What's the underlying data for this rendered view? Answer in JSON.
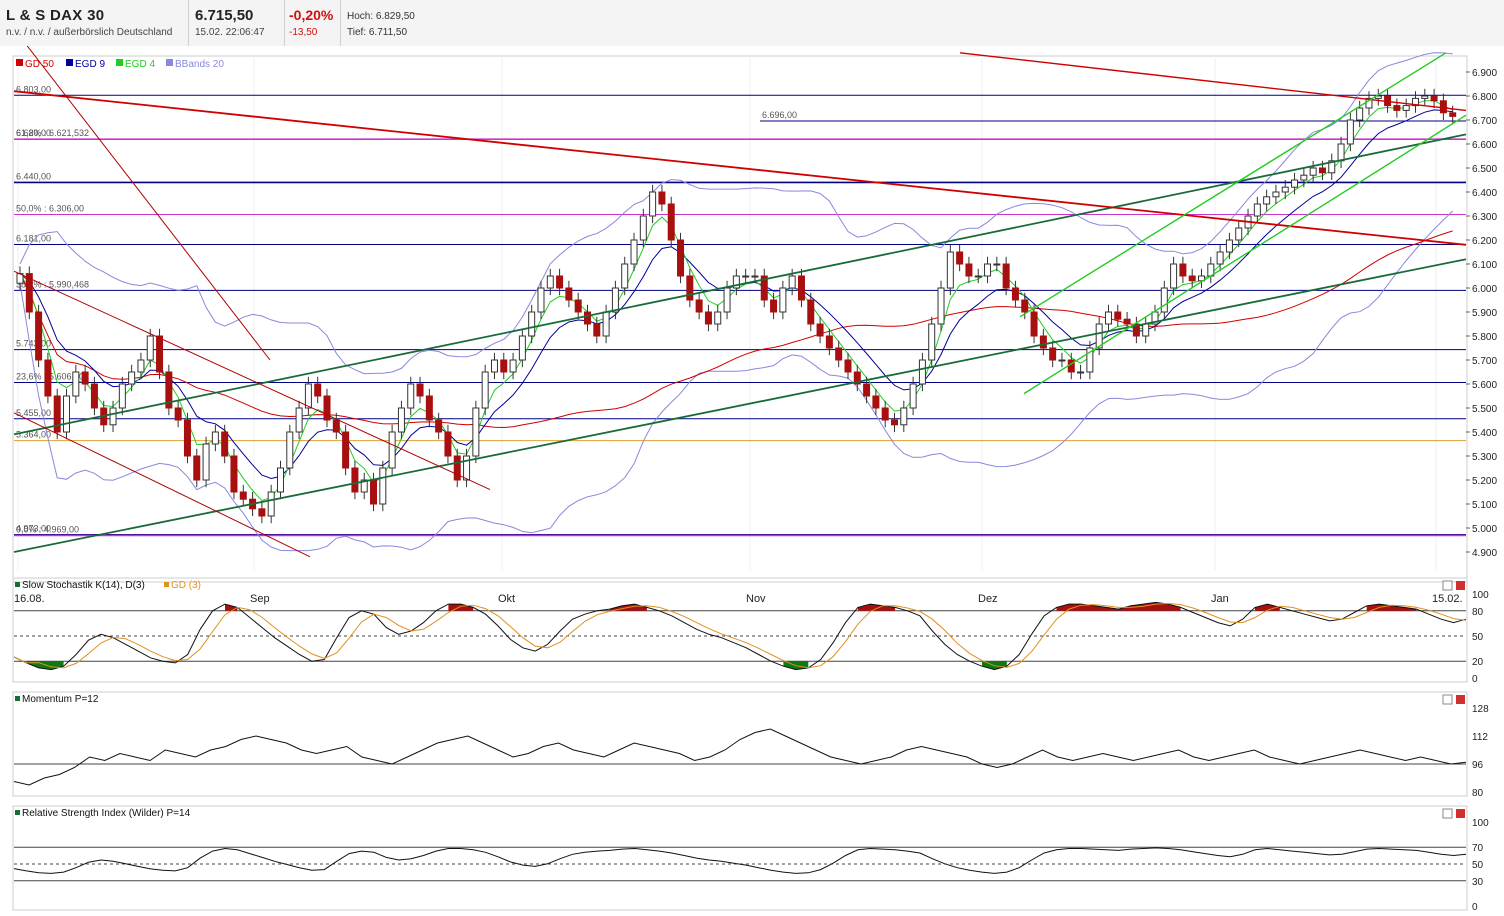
{
  "header": {
    "name": "L & S DAX 30",
    "exchange": "n.v. / n.v. / außerbörslich Deutschland",
    "price": "6.715,50",
    "datetime": "15.02. 22:06:47",
    "change_pct": "-0,20%",
    "change_abs": "-13,50",
    "high": "Hoch: 6.829,50",
    "low": "Tief: 6.711,50"
  },
  "colors": {
    "up": "#ffffff",
    "down": "#a80f0f",
    "gd50": "#d00000",
    "egd9": "#000099",
    "egd4": "#22cc22",
    "bbands": "#8888dd",
    "trend": "#1a6b3a",
    "hline": "#000080",
    "fib": "#cc33cc",
    "orange": "#e0a030"
  },
  "legend": [
    {
      "label": "GD 50",
      "color": "#d00000"
    },
    {
      "label": "EGD 9",
      "color": "#000099"
    },
    {
      "label": "EGD 4",
      "color": "#22cc22"
    },
    {
      "label": "BBands 20",
      "color": "#8888dd"
    }
  ],
  "panels": {
    "stoch": {
      "title": "Slow Stochastik K(14), D(3)",
      "title2": "GD (3)",
      "ticks": [
        "100",
        "80",
        "50",
        "20",
        "0"
      ]
    },
    "mom": {
      "title": "Momentum P=12",
      "ticks": [
        "128",
        "112",
        "96",
        "80"
      ]
    },
    "rsi": {
      "title": "Relative Strength Index (Wilder) P=14",
      "ticks": [
        "100",
        "70",
        "50",
        "30",
        "0"
      ]
    }
  },
  "chart_data": {
    "type": "candlestick",
    "x_labels": [
      "16.08.",
      "Sep",
      "Okt",
      "Nov",
      "Dez",
      "Jan",
      "15.02."
    ],
    "y_ticks": [
      "6.900",
      "6.800",
      "6.700",
      "6.600",
      "6.500",
      "6.400",
      "6.300",
      "6.200",
      "6.100",
      "6.000",
      "5.900",
      "5.800",
      "5.700",
      "5.600",
      "5.500",
      "5.400",
      "5.300",
      "5.200",
      "5.100",
      "5.000",
      "4.900"
    ],
    "ylim": [
      4900,
      6900
    ],
    "level_labels": [
      {
        "text": "6.803,00",
        "value": 6803
      },
      {
        "text": "6.696,00",
        "value": 6696
      },
      {
        "text": "6.620,00",
        "value": 6620
      },
      {
        "text": "61,8% : 6.621,532",
        "value": 6621
      },
      {
        "text": "6.440,00",
        "value": 6440
      },
      {
        "text": "50,0% : 6.306,00",
        "value": 6306
      },
      {
        "text": "6.181,00",
        "value": 6181
      },
      {
        "text": "38,2% : 5.990,468",
        "value": 5990
      },
      {
        "text": "5.743,00",
        "value": 5743
      },
      {
        "text": "23,6% : 5.606,00",
        "value": 5606
      },
      {
        "text": "5.455,00",
        "value": 5455
      },
      {
        "text": "5.364,00",
        "value": 5364
      },
      {
        "text": "4.973,00",
        "value": 4973
      },
      {
        "text": "0,0% : 4.969,00",
        "value": 4969
      }
    ],
    "close": [
      6060,
      5900,
      5700,
      5550,
      5400,
      5550,
      5650,
      5600,
      5500,
      5430,
      5500,
      5600,
      5650,
      5700,
      5800,
      5650,
      5500,
      5450,
      5300,
      5200,
      5350,
      5400,
      5300,
      5150,
      5120,
      5080,
      5050,
      5150,
      5250,
      5400,
      5500,
      5600,
      5550,
      5450,
      5400,
      5250,
      5150,
      5200,
      5100,
      5250,
      5400,
      5500,
      5600,
      5550,
      5450,
      5400,
      5300,
      5200,
      5300,
      5500,
      5650,
      5700,
      5650,
      5700,
      5800,
      5900,
      6000,
      6050,
      6000,
      5950,
      5900,
      5850,
      5800,
      5900,
      6000,
      6100,
      6200,
      6300,
      6400,
      6350,
      6200,
      6050,
      5950,
      5900,
      5850,
      5900,
      6000,
      6050,
      6050,
      6050,
      5950,
      5900,
      6000,
      6050,
      5950,
      5850,
      5800,
      5750,
      5700,
      5650,
      5600,
      5550,
      5500,
      5450,
      5430,
      5500,
      5600,
      5700,
      5850,
      6000,
      6150,
      6100,
      6050,
      6050,
      6100,
      6100,
      6000,
      5950,
      5900,
      5800,
      5750,
      5700,
      5700,
      5650,
      5650,
      5750,
      5850,
      5900,
      5870,
      5850,
      5800,
      5850,
      5900,
      6000,
      6100,
      6050,
      6030,
      6050,
      6100,
      6150,
      6200,
      6250,
      6300,
      6350,
      6380,
      6400,
      6420,
      6450,
      6470,
      6500,
      6480,
      6530,
      6600,
      6700,
      6750,
      6790,
      6800,
      6760,
      6740,
      6760,
      6790,
      6800,
      6780,
      6730,
      6715
    ],
    "stoch_k": [
      25,
      18,
      12,
      10,
      14,
      28,
      45,
      52,
      48,
      40,
      32,
      24,
      20,
      18,
      28,
      58,
      80,
      88,
      84,
      72,
      60,
      48,
      38,
      28,
      20,
      22,
      48,
      72,
      80,
      76,
      60,
      52,
      56,
      66,
      80,
      88,
      88,
      84,
      76,
      62,
      46,
      36,
      32,
      40,
      56,
      70,
      76,
      80,
      82,
      86,
      88,
      84,
      80,
      74,
      66,
      58,
      52,
      48,
      42,
      36,
      28,
      20,
      14,
      10,
      12,
      22,
      42,
      66,
      84,
      88,
      86,
      84,
      80,
      74,
      56,
      40,
      28,
      20,
      14,
      10,
      14,
      28,
      52,
      74,
      84,
      88,
      88,
      86,
      84,
      82,
      86,
      88,
      90,
      88,
      84,
      78,
      72,
      66,
      62,
      70,
      84,
      88,
      84,
      80,
      76,
      72,
      68,
      70,
      78,
      86,
      88,
      86,
      84,
      82,
      76,
      70,
      66,
      70
    ],
    "momentum": [
      86,
      84,
      88,
      90,
      94,
      100,
      98,
      102,
      100,
      98,
      104,
      102,
      100,
      104,
      106,
      110,
      112,
      110,
      108,
      104,
      102,
      104,
      106,
      100,
      98,
      96,
      100,
      104,
      108,
      110,
      112,
      108,
      104,
      100,
      102,
      106,
      108,
      104,
      102,
      100,
      104,
      108,
      106,
      104,
      102,
      98,
      100,
      104,
      110,
      114,
      116,
      112,
      108,
      104,
      100,
      98,
      96,
      98,
      100,
      104,
      106,
      104,
      102,
      100,
      96,
      94,
      96,
      100,
      104,
      100,
      98,
      100,
      102,
      100,
      98,
      100,
      102,
      104,
      100,
      98,
      100,
      102,
      104,
      100,
      98,
      96,
      98,
      100,
      102,
      104,
      102,
      100,
      98,
      100,
      98,
      96,
      97
    ]
  }
}
